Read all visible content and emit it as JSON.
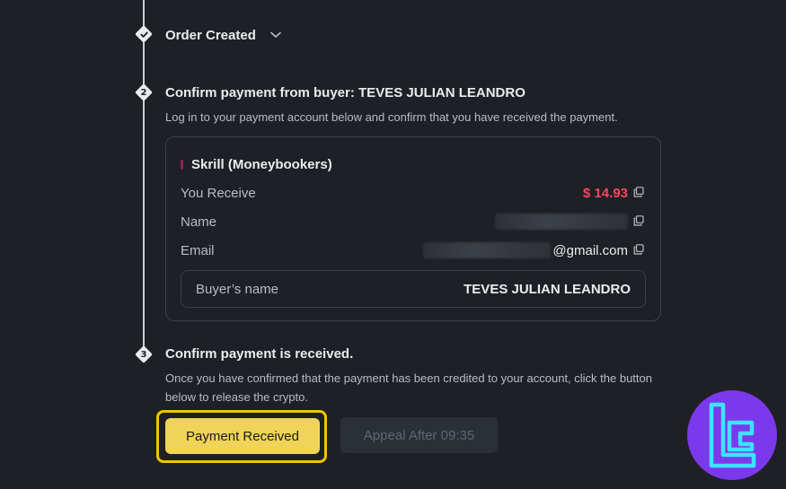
{
  "steps": [
    {
      "marker": "check",
      "title": "Order Created"
    },
    {
      "marker": "2",
      "title": "Confirm payment from buyer: TEVES JULIAN LEANDRO",
      "description": "Log in to your payment account below and confirm that you have received the payment."
    },
    {
      "marker": "3",
      "title": "Confirm payment is received.",
      "description": "Once you have confirmed that the payment has been credited to your account, click the button below to release the crypto."
    }
  ],
  "payment": {
    "method": "Skrill (Moneybookers)",
    "rows": {
      "receive_label": "You Receive",
      "receive_value": "$ 14.93",
      "name_label": "Name",
      "email_label": "Email",
      "email_suffix": "@gmail.com"
    },
    "buyer_label": "Buyer’s name",
    "buyer_value": "TEVES JULIAN LEANDRO"
  },
  "buttons": {
    "primary": "Payment Received",
    "secondary": "Appeal After 09:35"
  },
  "colors": {
    "background": "#1e2026",
    "accent_yellow": "#f0d358",
    "highlight_border": "#f0c600",
    "amount_red": "#f6465d",
    "logo_purple": "#7b39ec",
    "logo_cyan": "#3de3ff"
  },
  "icons": {
    "step_done": "check-icon",
    "expand": "chevron-down-icon",
    "copy": "copy-icon",
    "brand": "tc-logo"
  }
}
